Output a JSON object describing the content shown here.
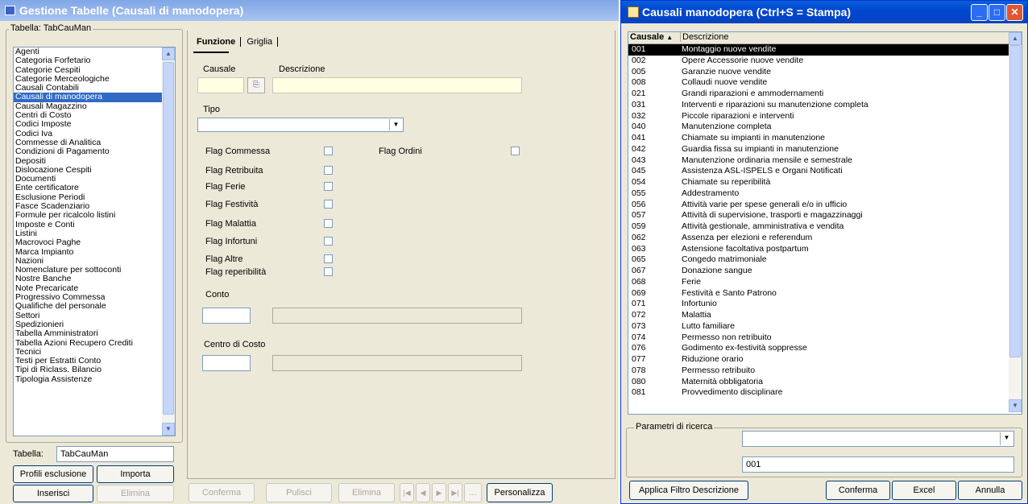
{
  "left_window": {
    "title": "Gestione Tabelle (Causali di manodopera)",
    "table_group_label": "Tabella: TabCauMan",
    "tables": [
      "Agenti",
      "Categoria Forfetario",
      "Categorie Cespiti",
      "Categorie Merceologiche",
      "Causali Contabili",
      "Causali di manodopera",
      "Causali Magazzino",
      "Centri di Costo",
      "Codici Imposte",
      "Codici Iva",
      "Commesse di Analitica",
      "Condizioni di Pagamento",
      "Depositi",
      "Dislocazione Cespiti",
      "Documenti",
      "Ente certificatore",
      "Esclusione Periodi",
      "Fasce Scadenziario",
      "Formule per ricalcolo listini",
      "Imposte e Conti",
      "Listini",
      "Macrovoci Paghe",
      "Marca Impianto",
      "Nazioni",
      "Nomenclature per sottoconti",
      "Nostre Banche",
      "Note Precaricate",
      "Progressivo Commessa",
      "Qualifiche del personale",
      "Settori",
      "Spedizionieri",
      "Tabella Amministratori",
      "Tabella Azioni Recupero Crediti",
      "Tecnici",
      "Testi per Estratti Conto",
      "Tipi di Riclass. Bilancio",
      "Tipologia Assistenze"
    ],
    "selected_table_index": 5,
    "tabella_label": "Tabella:",
    "tabella_value": "TabCauMan",
    "buttons": {
      "profili": "Profili esclusione",
      "importa": "Importa",
      "inserisci": "Inserisci",
      "elimina": "Elimina"
    },
    "tabs": [
      "Funzione",
      "Griglia"
    ],
    "form": {
      "causale_label": "Causale",
      "descrizione_label": "Descrizione",
      "tipo_label": "Tipo",
      "flag_commessa": "Flag Commessa",
      "flag_ordini": "Flag Ordini",
      "flag_retribuita": "Flag Retribuita",
      "flag_ferie": "Flag Ferie",
      "flag_festivita": "Flag Festività",
      "flag_malattia": "Flag Malattia",
      "flag_infortuni": "Flag Infortuni",
      "flag_altre": "Flag Altre",
      "flag_reperibilita": "Flag reperibilità",
      "conto_label": "Conto",
      "centro_label": "Centro di Costo"
    },
    "bottom_bar": {
      "conferma": "Conferma",
      "pulisci": "Pulisci",
      "elimina": "Elimina",
      "more": "...",
      "personalizza": "Personalizza"
    }
  },
  "right_window": {
    "title": "Causali manodopera (Ctrl+S = Stampa)",
    "columns": {
      "code": "Causale",
      "sort_arrow": "▲",
      "desc": "Descrizione"
    },
    "rows": [
      [
        "001",
        "Montaggio nuove vendite"
      ],
      [
        "002",
        "Opere Accessorie nuove vendite"
      ],
      [
        "005",
        "Garanzie nuove vendite"
      ],
      [
        "008",
        "Collaudi nuove vendite"
      ],
      [
        "021",
        "Grandi riparazioni e ammodernamenti"
      ],
      [
        "031",
        "Interventi e riparazioni su manutenzione completa"
      ],
      [
        "032",
        "Piccole riparazioni e interventi"
      ],
      [
        "040",
        "Manutenzione completa"
      ],
      [
        "041",
        "Chiamate su impianti in manutenzione"
      ],
      [
        "042",
        "Guardia fissa su impianti in manutenzione"
      ],
      [
        "043",
        "Manutenzione ordinaria mensile e semestrale"
      ],
      [
        "045",
        "Assistenza ASL-ISPELS e Organi Notificati"
      ],
      [
        "054",
        "Chiamate su reperibilità"
      ],
      [
        "055",
        "Addestramento"
      ],
      [
        "056",
        "Attività varie per spese generali e/o in ufficio"
      ],
      [
        "057",
        "Attività di supervisione, trasporti e magazzinaggi"
      ],
      [
        "059",
        "Attività gestionale, amministrativa e vendita"
      ],
      [
        "062",
        "Assenza per elezioni e referendum"
      ],
      [
        "063",
        "Astensione facoltativa postpartum"
      ],
      [
        "065",
        "Congedo matrimoniale"
      ],
      [
        "067",
        "Donazione sangue"
      ],
      [
        "068",
        "Ferie"
      ],
      [
        "069",
        "Festività e Santo Patrono"
      ],
      [
        "071",
        "Infortunio"
      ],
      [
        "072",
        "Malattia"
      ],
      [
        "073",
        "Lutto familiare"
      ],
      [
        "074",
        "Permesso non retribuito"
      ],
      [
        "076",
        "Godimento ex-festività soppresse"
      ],
      [
        "077",
        "Riduzione orario"
      ],
      [
        "078",
        "Permesso retribuito"
      ],
      [
        "080",
        "Maternità obbligatoria"
      ],
      [
        "081",
        "Provvedimento disciplinare"
      ]
    ],
    "search_group": "Parametri di ricerca",
    "search_value": "001",
    "buttons": {
      "filtro": "Applica Filtro Descrizione",
      "conferma": "Conferma",
      "excel": "Excel",
      "annulla": "Annulla"
    }
  }
}
